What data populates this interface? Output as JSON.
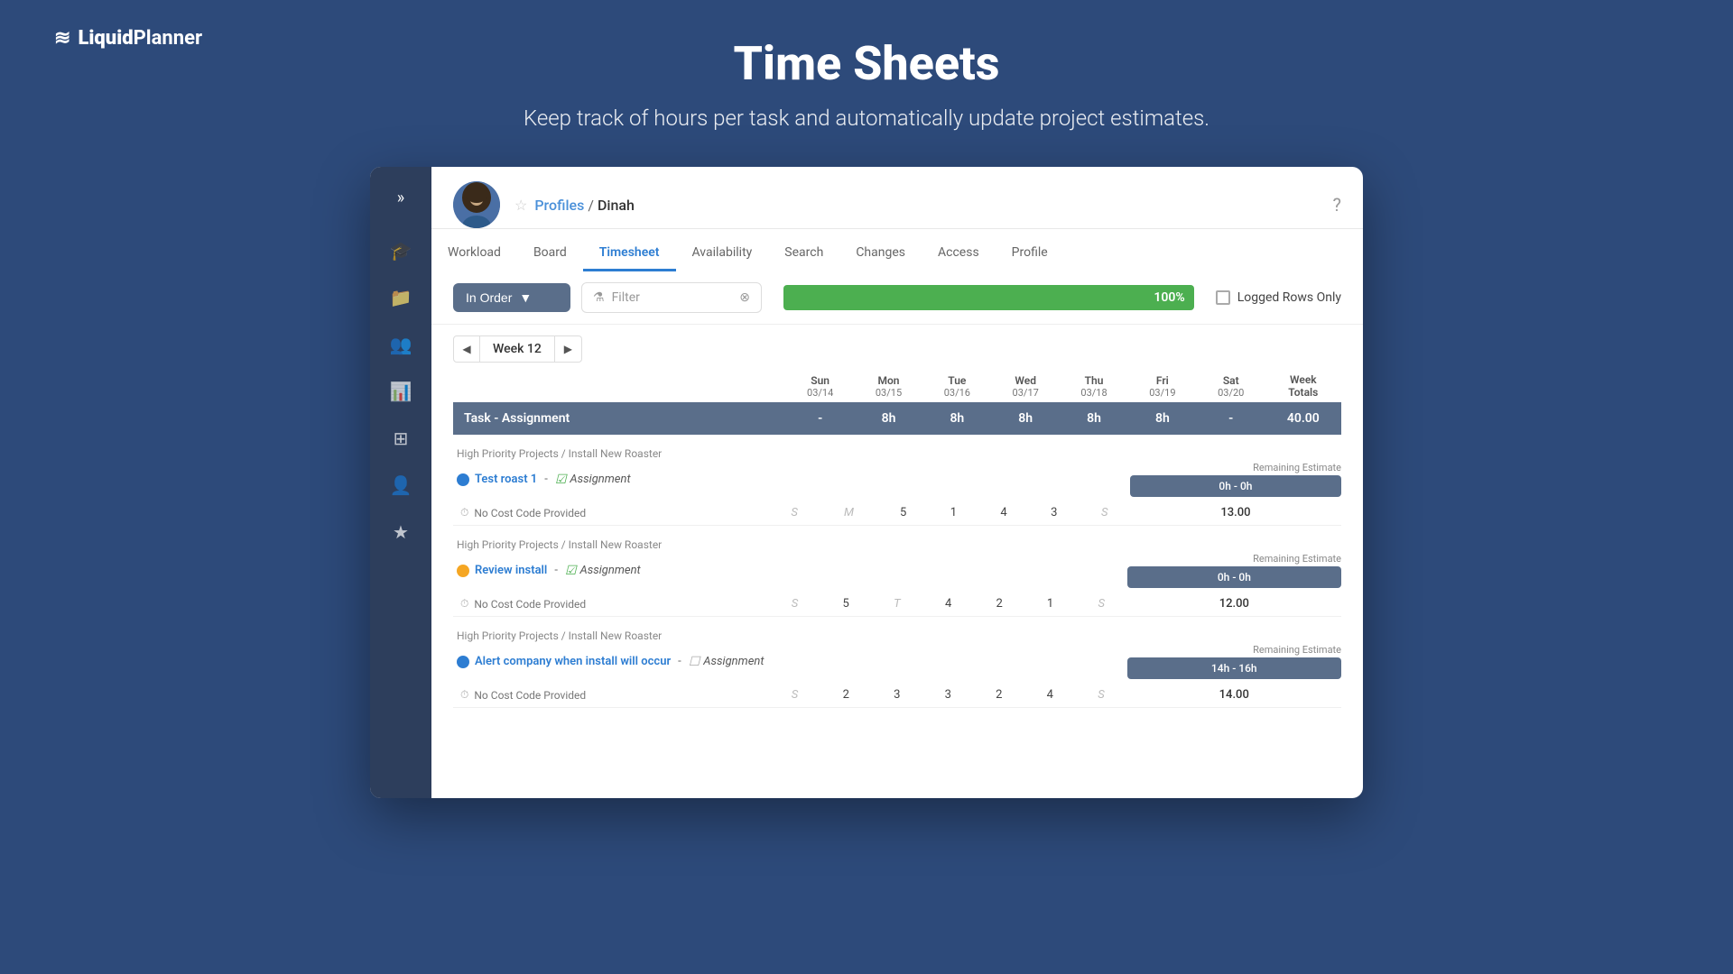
{
  "logo": {
    "waves": "≋",
    "brand_bold": "Liquid",
    "brand_light": "Planner"
  },
  "hero": {
    "title": "Time Sheets",
    "subtitle": "Keep track of hours per task and automatically update project estimates."
  },
  "sidebar": {
    "toggle": "»",
    "items": [
      {
        "icon": "🎓",
        "name": "learn"
      },
      {
        "icon": "📁",
        "name": "projects"
      },
      {
        "icon": "👥",
        "name": "people"
      },
      {
        "icon": "📊",
        "name": "reports"
      },
      {
        "icon": "⊞",
        "name": "dashboard"
      },
      {
        "icon": "👤",
        "name": "profile"
      },
      {
        "icon": "★",
        "name": "favorites"
      }
    ]
  },
  "profile": {
    "breadcrumb_star": "☆",
    "profiles_label": "Profiles",
    "separator": "/",
    "current_user": "Dinah",
    "help_icon": "?"
  },
  "tabs": [
    {
      "label": "Workload",
      "active": false
    },
    {
      "label": "Board",
      "active": false
    },
    {
      "label": "Timesheet",
      "active": true
    },
    {
      "label": "Availability",
      "active": false
    },
    {
      "label": "Search",
      "active": false
    },
    {
      "label": "Changes",
      "active": false
    },
    {
      "label": "Access",
      "active": false
    },
    {
      "label": "Profile",
      "active": false
    }
  ],
  "toolbar": {
    "sort_label": "In Order",
    "filter_placeholder": "Filter",
    "progress_percent": "100%",
    "logged_rows_label": "Logged Rows Only"
  },
  "week": {
    "label": "Week 12",
    "days": [
      {
        "name": "Sun",
        "date": "03/14"
      },
      {
        "name": "Mon",
        "date": "03/15"
      },
      {
        "name": "Tue",
        "date": "03/16"
      },
      {
        "name": "Wed",
        "date": "03/17"
      },
      {
        "name": "Thu",
        "date": "03/18"
      },
      {
        "name": "Fri",
        "date": "03/19"
      },
      {
        "name": "Sat",
        "date": "03/20"
      }
    ],
    "week_totals_label": "Week\nTotals"
  },
  "task_assignment_row": {
    "label": "Task - Assignment",
    "sun": "-",
    "mon": "8h",
    "tue": "8h",
    "wed": "8h",
    "thu": "8h",
    "fri": "8h",
    "sat": "-",
    "total": "40.00"
  },
  "rows": [
    {
      "project_path": "High Priority Projects / Install New Roaster",
      "task_icon": "blue",
      "task_name": "Test roast 1",
      "assignment_checked": true,
      "assignment_label": "Assignment",
      "remaining_label": "Remaining Estimate",
      "remaining_value": "0h - 0h",
      "cost_code": "No Cost Code Provided",
      "sun": "S",
      "mon": "M",
      "tue": "5",
      "wed": "1",
      "thu": "4",
      "fri": "3",
      "sat": "S",
      "total": "13.00"
    },
    {
      "project_path": "High Priority Projects / Install New Roaster",
      "task_icon": "orange",
      "task_name": "Review install",
      "assignment_checked": true,
      "assignment_label": "Assignment",
      "remaining_label": "Remaining Estimate",
      "remaining_value": "0h - 0h",
      "cost_code": "No Cost Code Provided",
      "sun": "S",
      "mon": "5",
      "tue": "T",
      "wed": "4",
      "thu": "2",
      "fri": "1",
      "sat": "S",
      "total": "12.00"
    },
    {
      "project_path": "High Priority Projects / Install New Roaster",
      "task_icon": "blue",
      "task_name": "Alert company when install will occur",
      "assignment_checked": false,
      "assignment_label": "Assignment",
      "remaining_label": "Remaining Estimate",
      "remaining_value": "14h - 16h",
      "cost_code": "No Cost Code Provided",
      "sun": "S",
      "mon": "2",
      "tue": "3",
      "wed": "3",
      "thu": "2",
      "fri": "4",
      "sat": "S",
      "total": "14.00"
    }
  ]
}
